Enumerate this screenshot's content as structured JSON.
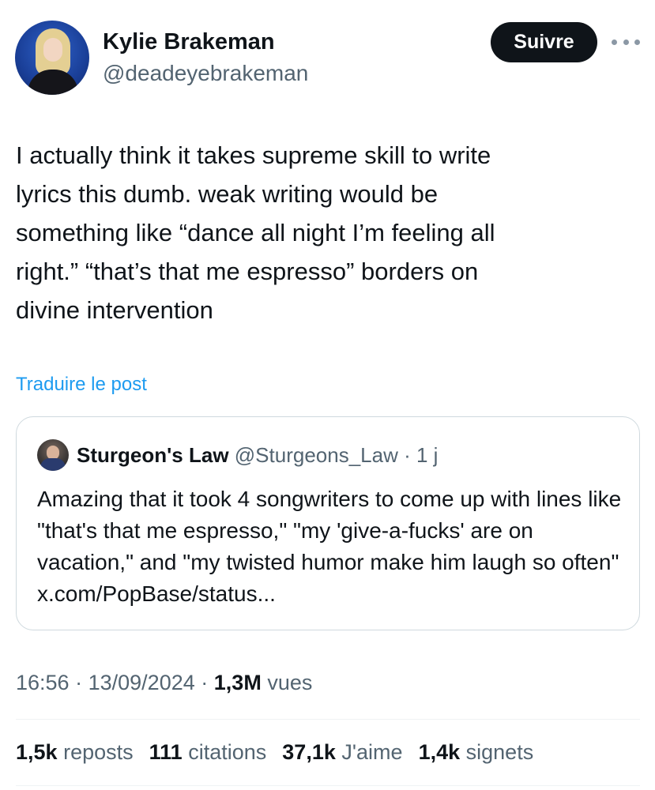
{
  "author": {
    "name": "Kylie Brakeman",
    "handle": "@deadeyebrakeman",
    "follow_label": "Suivre"
  },
  "tweet": {
    "text": "I actually think it takes supreme skill to write\nlyrics this dumb. weak writing would be\nsomething like “dance all night I’m feeling all\nright.” “that’s that me espresso” borders on\ndivine intervention",
    "translate_label": "Traduire le post"
  },
  "quoted": {
    "name": "Sturgeon's Law",
    "handle": "@Sturgeons_Law",
    "separator": "·",
    "age": "1 j",
    "text": "Amazing that it took 4 songwriters to come up with lines like \"that's that me espresso,\" \"my 'give-a-fucks' are on vacation,\" and \"my twisted humor make him laugh so often\" x.com/PopBase/status..."
  },
  "meta": {
    "time": "16:56",
    "date": "13/09/2024",
    "separator": "·",
    "views_count": "1,3M",
    "views_label": "vues"
  },
  "stats": {
    "reposts_count": "1,5k",
    "reposts_label": "reposts",
    "quotes_count": "111",
    "quotes_label": "citations",
    "likes_count": "37,1k",
    "likes_label": "J'aime",
    "bookmarks_count": "1,4k",
    "bookmarks_label": "signets"
  },
  "icons": {
    "more": "more-horizontal-icon"
  },
  "colors": {
    "accent": "#1d9bf0",
    "text": "#0f1419",
    "muted": "#536471",
    "border": "#cfd9de"
  }
}
